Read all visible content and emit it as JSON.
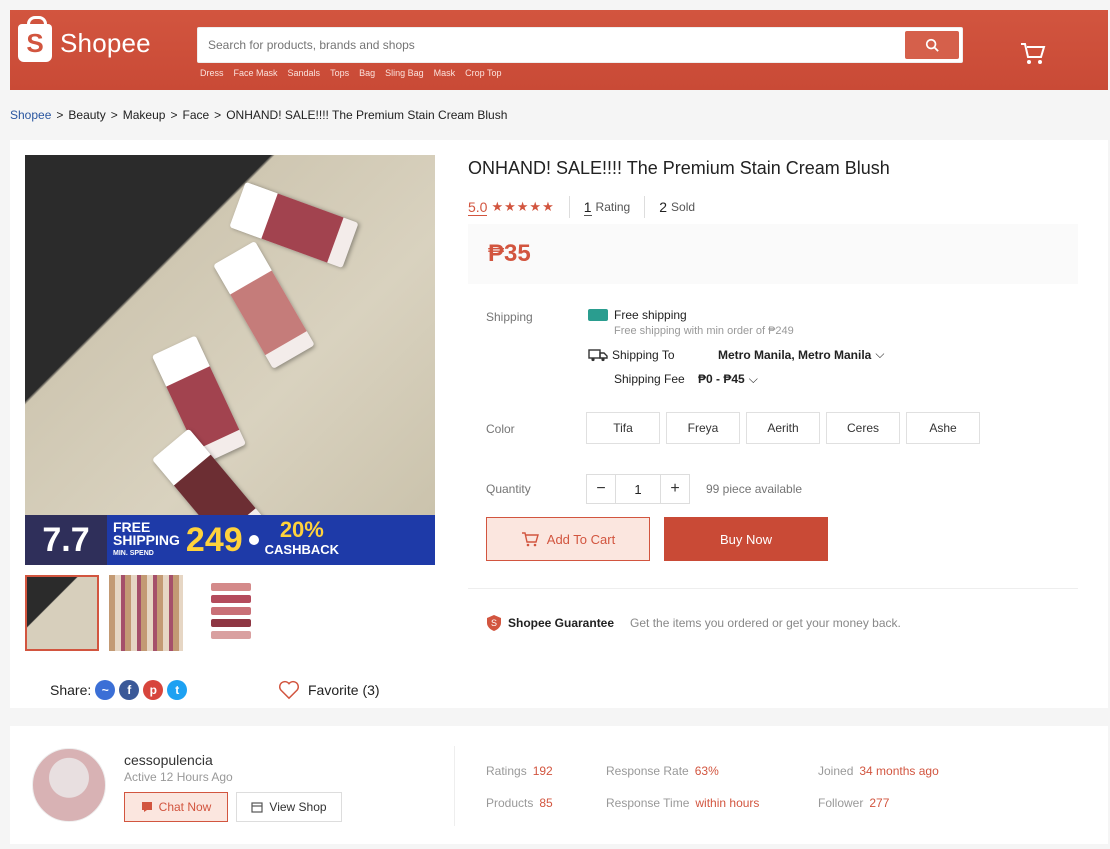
{
  "header": {
    "logo_text": "Shopee",
    "search_placeholder": "Search for products, brands and shops",
    "hot_words": [
      "Dress",
      "Face Mask",
      "Sandals",
      "Tops",
      "Bag",
      "Sling Bag",
      "Mask",
      "Crop Top"
    ]
  },
  "breadcrumb": [
    "Shopee",
    "Beauty",
    "Makeup",
    "Face",
    "ONHAND! SALE!!!! The Premium Stain Cream Blush"
  ],
  "product": {
    "title": "ONHAND! SALE!!!! The Premium Stain Cream Blush",
    "rating": "5.0",
    "stars": "★★★★★",
    "rating_count": "1",
    "rating_label": "Rating",
    "sold_count": "2",
    "sold_label": "Sold",
    "price": "₱35",
    "promo": {
      "badge": "7.7",
      "free": "FREE",
      "shipping": "SHIPPING",
      "min_spend": "MIN. SPEND",
      "amount": "249",
      "cashback_pct": "20%",
      "cashback": "CASHBACK"
    },
    "labels": {
      "shipping": "Shipping",
      "color": "Color",
      "quantity": "Quantity"
    },
    "shipping": {
      "free_title": "Free shipping",
      "free_sub": "Free shipping with min order of ₱249",
      "to_label": "Shipping To",
      "to_value": "Metro Manila, Metro Manila",
      "fee_label": "Shipping Fee",
      "fee_value": "₱0 - ₱45"
    },
    "colors": [
      "Tifa",
      "Freya",
      "Aerith",
      "Ceres",
      "Ashe"
    ],
    "quantity": {
      "minus": "−",
      "value": "1",
      "plus": "+",
      "available": "99 piece available"
    },
    "add_to_cart": "Add To Cart",
    "buy_now": "Buy Now",
    "guarantee_title": "Shopee Guarantee",
    "guarantee_desc": "Get the items you ordered or get your money back.",
    "share_label": "Share:",
    "favorite": "Favorite (3)"
  },
  "shop": {
    "name": "cessopulencia",
    "active": "Active 12 Hours Ago",
    "chat_now": "Chat Now",
    "view_shop": "View Shop",
    "stats": {
      "ratings_label": "Ratings",
      "ratings_value": "192",
      "products_label": "Products",
      "products_value": "85",
      "response_rate_label": "Response Rate",
      "response_rate_value": "63%",
      "response_time_label": "Response Time",
      "response_time_value": "within hours",
      "joined_label": "Joined",
      "joined_value": "34 months ago",
      "follower_label": "Follower",
      "follower_value": "277"
    }
  },
  "colors": {
    "brand": "#d2553f",
    "brand_dark": "#c94a36",
    "link": "#2a56a0"
  }
}
